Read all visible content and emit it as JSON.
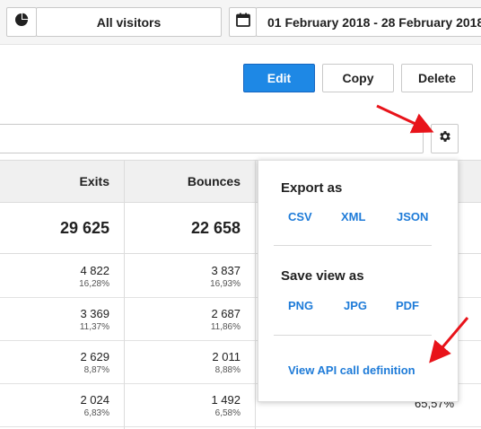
{
  "topbar": {
    "segment_label": "All visitors",
    "date_range": "01 February 2018 - 28 February 2018",
    "segment_icon": "pie-chart-icon",
    "calendar_icon": "calendar-icon"
  },
  "actions": {
    "edit": "Edit",
    "copy": "Copy",
    "delete": "Delete"
  },
  "search": {
    "value": ""
  },
  "table": {
    "columns": [
      "Exits",
      "Bounces"
    ],
    "totals": {
      "exits": "29 625",
      "bounces": "22 658"
    },
    "rows": [
      {
        "exits": "4 822",
        "exits_pct": "16,28%",
        "bounces": "3 837",
        "bounces_pct": "16,93%"
      },
      {
        "exits": "3 369",
        "exits_pct": "11,37%",
        "bounces": "2 687",
        "bounces_pct": "11,86%"
      },
      {
        "exits": "2 629",
        "exits_pct": "8,87%",
        "bounces": "2 011",
        "bounces_pct": "8,88%"
      },
      {
        "exits": "2 024",
        "exits_pct": "6,83%",
        "bounces": "1 492",
        "bounces_pct": "6,58%",
        "last_visible": "65,57%"
      }
    ]
  },
  "popup": {
    "export_heading": "Export as",
    "export_options": [
      "CSV",
      "XML",
      "JSON"
    ],
    "save_heading": "Save view as",
    "save_options": [
      "PNG",
      "JPG",
      "PDF"
    ],
    "api_link": "View API call definition"
  },
  "colors": {
    "accent": "#1e88e5",
    "link": "#1e7bd8",
    "annotation_arrow": "#e8131a"
  }
}
